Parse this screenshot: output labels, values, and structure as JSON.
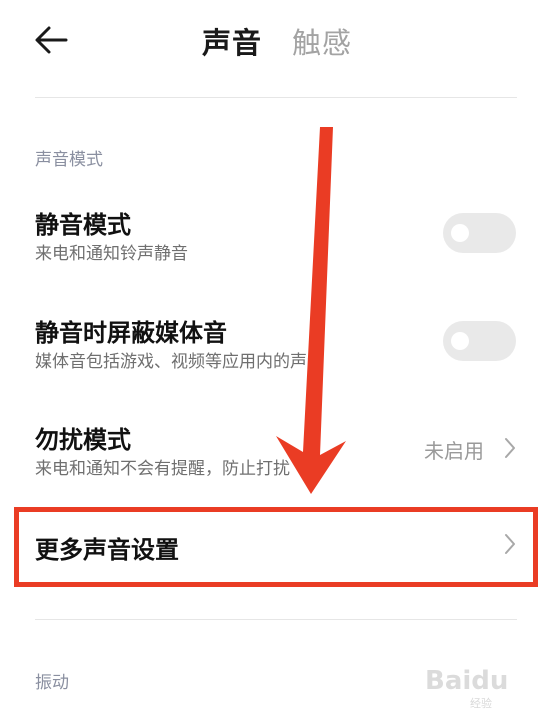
{
  "header": {
    "tabs": [
      {
        "label": "声音",
        "active": true
      },
      {
        "label": "触感",
        "active": false
      }
    ]
  },
  "section_sound_mode": {
    "label": "声音模式",
    "items": [
      {
        "title": "静音模式",
        "subtitle": "来电和通知铃声静音",
        "control": "toggle",
        "enabled": false
      },
      {
        "title": "静音时屏蔽媒体音",
        "subtitle": "媒体音包括游戏、视频等应用内的声音",
        "control": "toggle",
        "enabled": false
      },
      {
        "title": "勿扰模式",
        "subtitle": "来电和通知不会有提醒，防止打扰",
        "control": "value",
        "value": "未启用"
      }
    ]
  },
  "more_sound": {
    "title": "更多声音设置"
  },
  "section_vibration": {
    "label": "振动"
  },
  "watermark": {
    "text": "Baidu",
    "sub": "经验"
  },
  "colors": {
    "annotation": "#ea3c24",
    "toggle_off": "#e9e9e9",
    "section_label": "#8a8fa0"
  }
}
